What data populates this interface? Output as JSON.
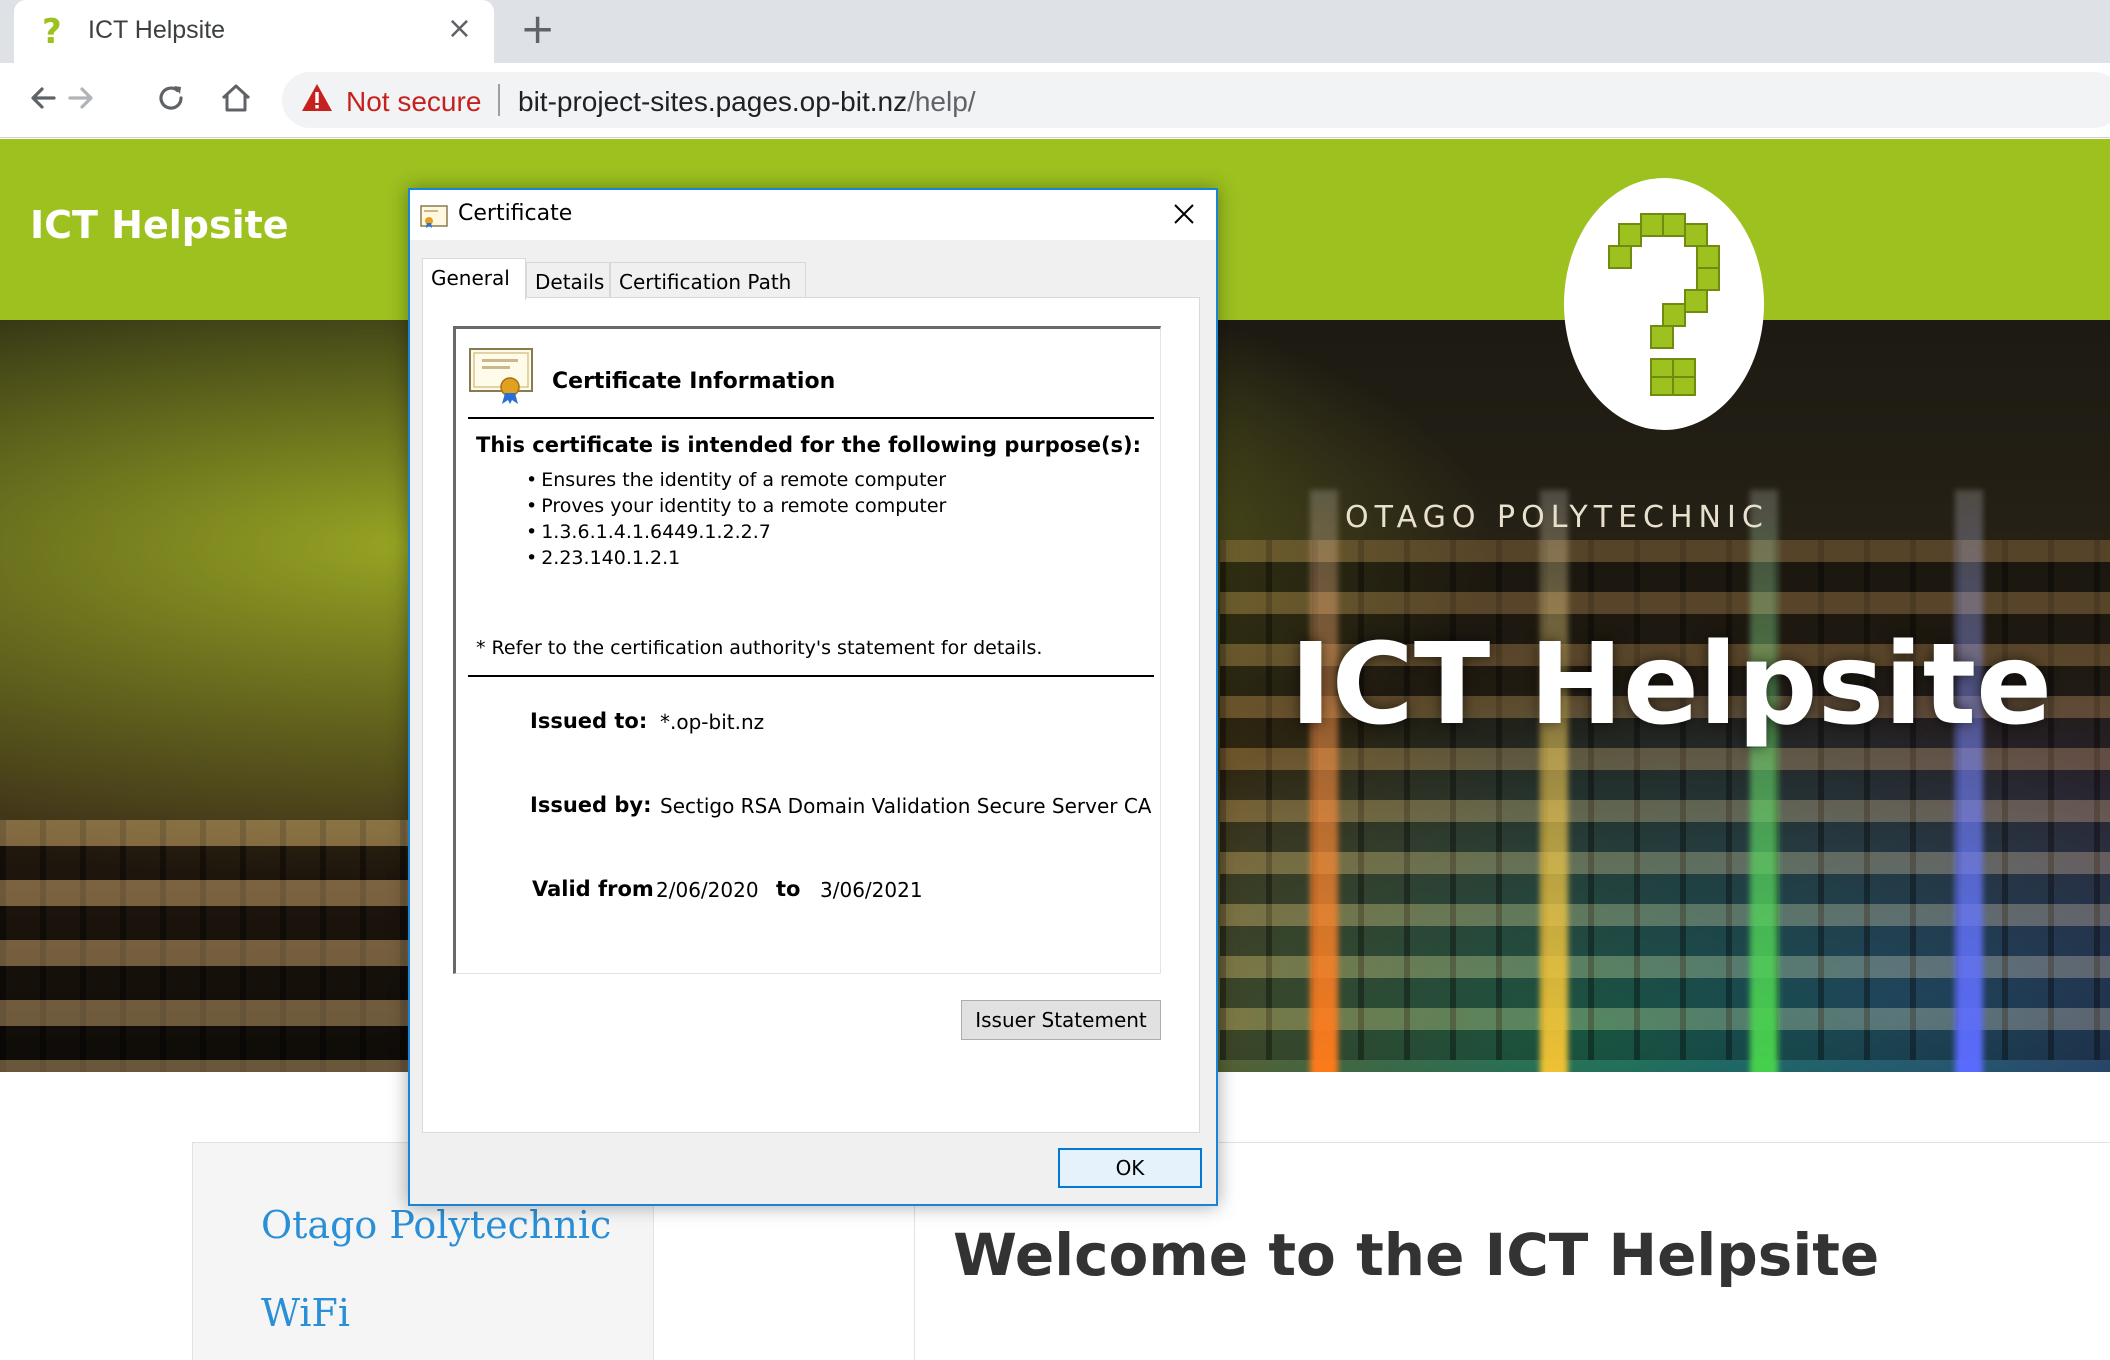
{
  "browser": {
    "tab_title": "ICT Helpsite",
    "tab_favicon": "?",
    "tab_close": "×",
    "new_tab": "+",
    "security_label": "Not secure",
    "url_host": "bit-project-sites.pages.op-bit.nz",
    "url_path": "/help/",
    "icons": [
      "back-icon",
      "forward-icon",
      "reload-icon",
      "home-icon",
      "warning-icon"
    ]
  },
  "site": {
    "brand": "ICT Helpsite",
    "hero_sign": "OTAGO POLYTECHNIC",
    "hero_title": "ICT Helpsite",
    "nav_links": [
      "Otago Polytechnic",
      "WiFi"
    ],
    "welcome": "Welcome to the ICT Helpsite",
    "accent_color": "#9dc11f",
    "link_color": "#2a8fd6"
  },
  "dialog": {
    "title": "Certificate",
    "close": "✕",
    "tabs": [
      "General",
      "Details",
      "Certification Path"
    ],
    "active_tab": "General",
    "info_heading": "Certificate Information",
    "purpose_title": "This certificate is intended for the following purpose(s):",
    "purposes": [
      "Ensures the identity of a remote computer",
      "Proves your identity to a remote computer",
      "1.3.6.1.4.1.6449.1.2.2.7",
      "2.23.140.1.2.1"
    ],
    "refer_note": "* Refer to the certification authority's statement for details.",
    "issued_to_label": "Issued to:",
    "issued_to": "*.op-bit.nz",
    "issued_by_label": "Issued by:",
    "issued_by": "Sectigo RSA Domain Validation Secure Server CA",
    "valid_from_label": "Valid from",
    "valid_from": "2/06/2020",
    "to_label": "to",
    "valid_to": "3/06/2021",
    "issuer_statement_button": "Issuer Statement",
    "ok_button": "OK"
  }
}
